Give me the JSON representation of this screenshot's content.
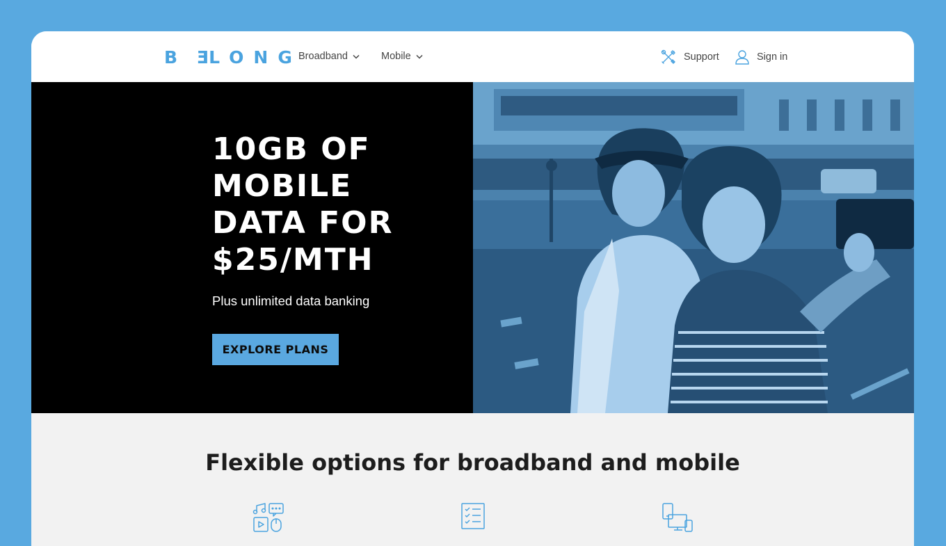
{
  "header": {
    "logo_text": "BELONG",
    "nav": [
      {
        "label": "Broadband"
      },
      {
        "label": "Mobile"
      }
    ],
    "support_label": "Support",
    "signin_label": "Sign in"
  },
  "hero": {
    "title": "10GB of mobile data for $25/mth",
    "subtitle": "Plus unlimited data banking",
    "cta_label": "EXPLORE PLANS"
  },
  "features": {
    "title": "Flexible options for broadband and mobile",
    "icons": [
      "media-devices-icon",
      "checklist-icon",
      "multi-device-icon"
    ]
  },
  "colors": {
    "background": "#59a9e0",
    "accent": "#4aa3df",
    "hero_bg": "#000000",
    "cta_bg": "#5aa8e0",
    "features_bg": "#f2f2f2"
  }
}
